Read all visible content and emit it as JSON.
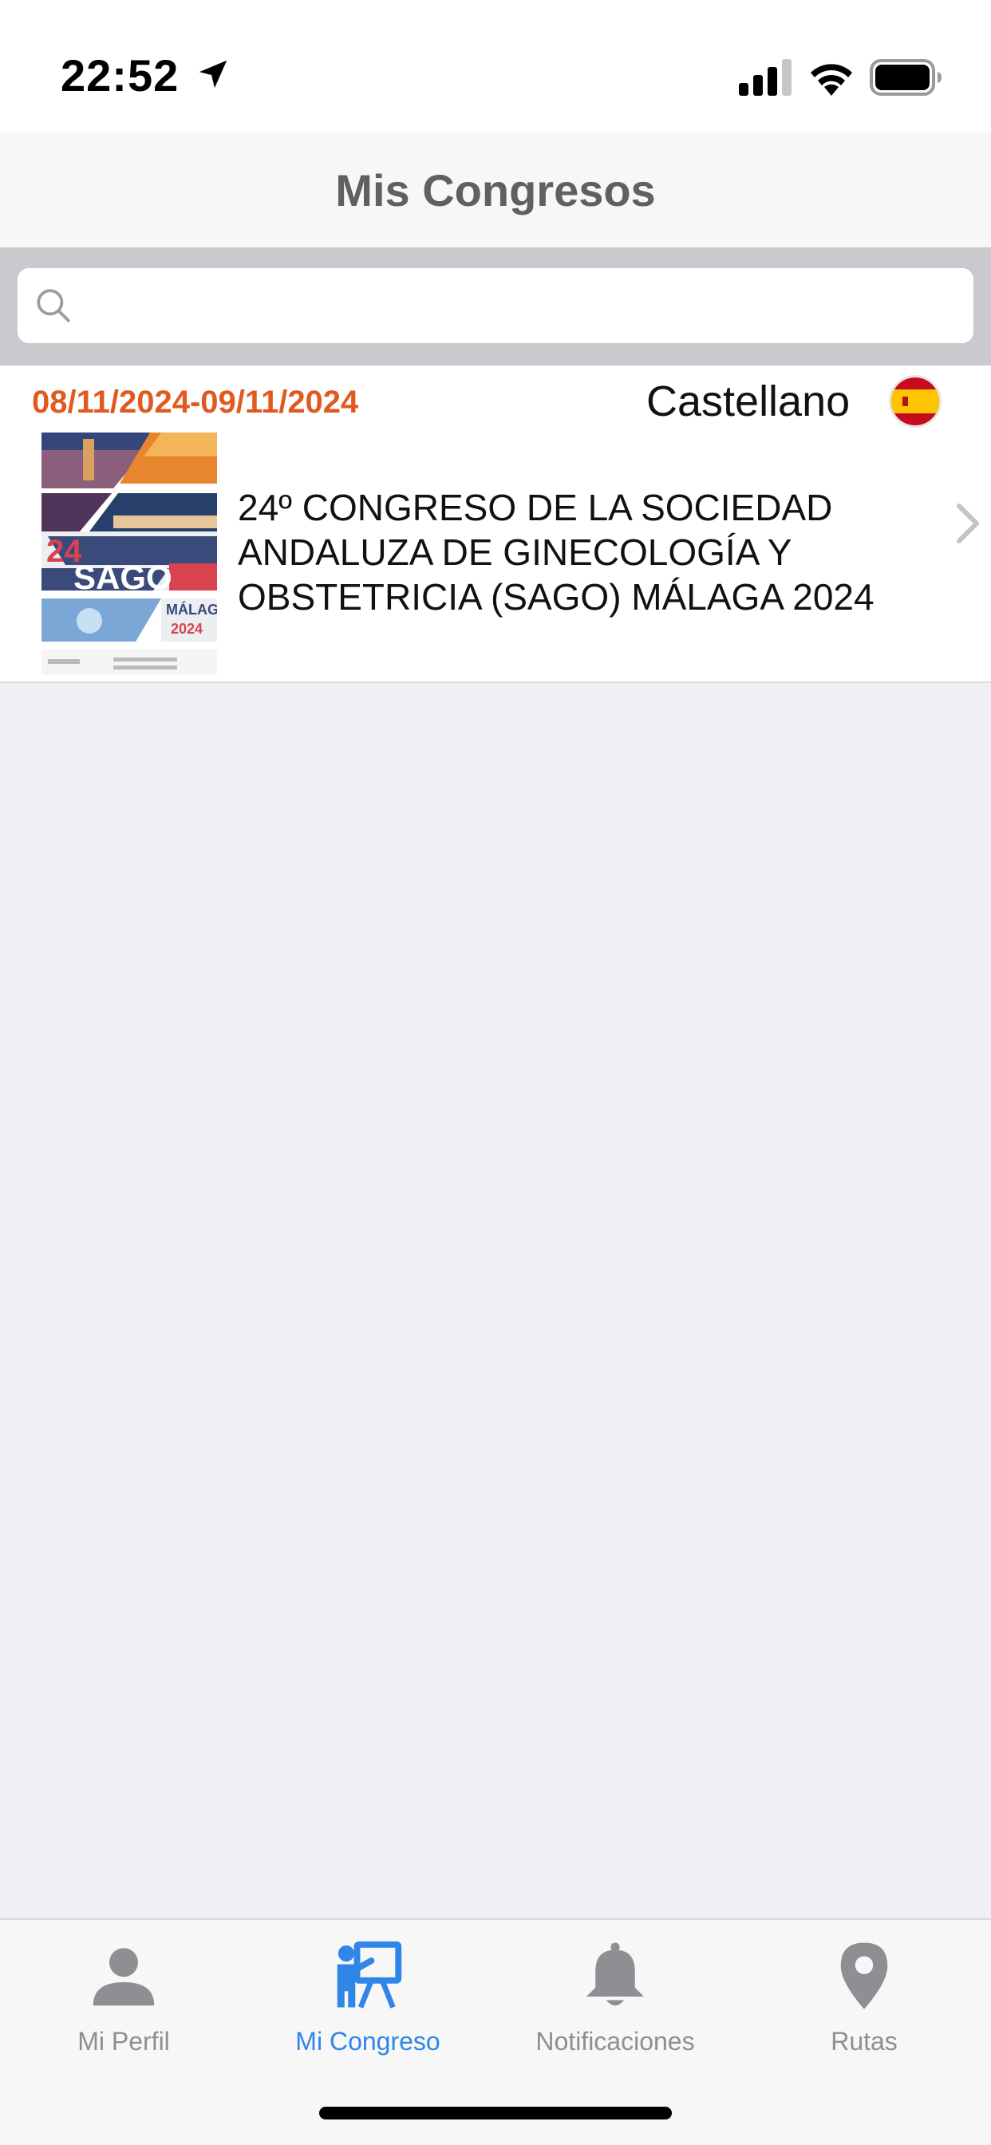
{
  "status_bar": {
    "time": "22:52"
  },
  "nav": {
    "title": "Mis Congresos"
  },
  "search": {
    "placeholder": "",
    "value": ""
  },
  "congresses": [
    {
      "dates": "08/11/2024-09/11/2024",
      "language": "Castellano",
      "flag": "spain-flag-icon",
      "title": "24º CONGRESO DE LA SOCIEDAD ANDALUZA DE GINECOLOGÍA Y OBSTETRICIA (SAGO) MÁLAGA 2024",
      "poster": {
        "number": "24",
        "acronym": "SAGO",
        "city": "MÁLAGA",
        "year": "2024"
      }
    }
  ],
  "tabs": [
    {
      "label": "Mi Perfil",
      "icon": "person-icon",
      "active": false
    },
    {
      "label": "Mi Congreso",
      "icon": "presentation-icon",
      "active": true
    },
    {
      "label": "Notificaciones",
      "icon": "bell-icon",
      "active": false
    },
    {
      "label": "Rutas",
      "icon": "map-pin-icon",
      "active": false
    }
  ],
  "colors": {
    "accent": "#2f86e8",
    "date": "#e05a20",
    "inactive_tab": "#8e8e93"
  }
}
